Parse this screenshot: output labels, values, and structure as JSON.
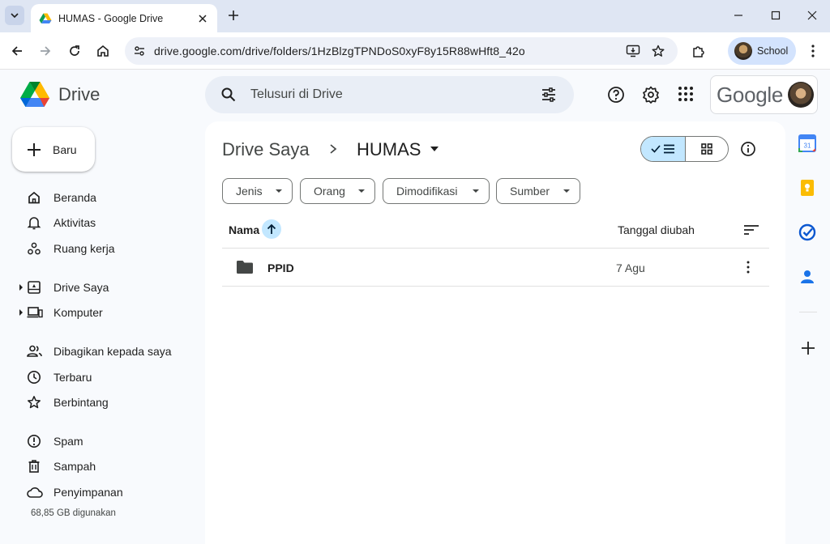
{
  "browser": {
    "tab_title": "HUMAS - Google Drive",
    "url": "drive.google.com/drive/folders/1HzBlzgTPNDoS0xyF8y15R88wHft8_42o",
    "profile_name": "School"
  },
  "app": {
    "name": "Drive",
    "search_placeholder": "Telusuri di Drive",
    "account_brand": "Google"
  },
  "sidebar": {
    "new_label": "Baru",
    "items": [
      {
        "label": "Beranda",
        "icon": "home-icon"
      },
      {
        "label": "Aktivitas",
        "icon": "bell-icon"
      },
      {
        "label": "Ruang kerja",
        "icon": "workspaces-icon"
      },
      {
        "label": "Drive Saya",
        "icon": "my-drive-icon"
      },
      {
        "label": "Komputer",
        "icon": "computer-icon"
      },
      {
        "label": "Dibagikan kepada saya",
        "icon": "shared-people-icon"
      },
      {
        "label": "Terbaru",
        "icon": "clock-icon"
      },
      {
        "label": "Berbintang",
        "icon": "star-icon"
      },
      {
        "label": "Spam",
        "icon": "spam-icon"
      },
      {
        "label": "Sampah",
        "icon": "trash-icon"
      },
      {
        "label": "Penyimpanan",
        "icon": "cloud-icon"
      }
    ],
    "storage_used": "68,85 GB digunakan"
  },
  "main": {
    "breadcrumb_parent": "Drive Saya",
    "breadcrumb_current": "HUMAS",
    "filters": [
      "Jenis",
      "Orang",
      "Dimodifikasi",
      "Sumber"
    ],
    "columns": {
      "name": "Nama",
      "modified": "Tanggal diubah"
    },
    "rows": [
      {
        "name": "PPID",
        "modified": "7 Agu",
        "type": "folder"
      }
    ]
  },
  "side_panel": {
    "apps": [
      "calendar-icon",
      "keep-icon",
      "tasks-icon",
      "contacts-icon"
    ]
  },
  "colors": {
    "accent_blue": "#0b57d0",
    "selected_bg": "#c2e7ff",
    "surface": "#f8fafd"
  }
}
